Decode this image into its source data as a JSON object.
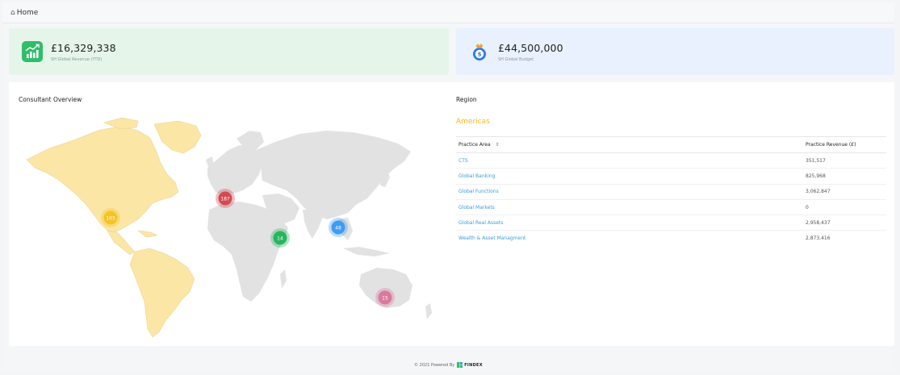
{
  "breadcrumb": {
    "label": "Home"
  },
  "cards": {
    "revenue": {
      "amount": "£16,329,338",
      "label": "SH Global Revenue (YTD)",
      "bg": "#e6f5ea",
      "icon": "growth-chart-icon"
    },
    "budget": {
      "amount": "£44,500,000",
      "label": "SH Global Budget",
      "bg": "#e8f1fd",
      "icon": "money-bag-icon"
    }
  },
  "overview": {
    "title": "Consultant Overview"
  },
  "map": {
    "markers": [
      {
        "region": "Americas",
        "value": "103",
        "color": "#f6c325"
      },
      {
        "region": "Europe",
        "value": "187",
        "color": "#d24a50"
      },
      {
        "region": "Africa",
        "value": "14",
        "color": "#27b65e"
      },
      {
        "region": "Asia",
        "value": "48",
        "color": "#3f9cf0"
      },
      {
        "region": "Oceania",
        "value": "15",
        "color": "#d9799e"
      }
    ]
  },
  "region": {
    "title": "Region",
    "selected": "Americas",
    "selected_color": "#f4b61d",
    "columns": {
      "area": "Practice Area",
      "revenue": "Practice Revenue (£)"
    },
    "rows": [
      {
        "area": "CTS",
        "revenue": "351,517"
      },
      {
        "area": "Global Banking",
        "revenue": "825,968"
      },
      {
        "area": "Global Functions",
        "revenue": "3,062,847"
      },
      {
        "area": "Global Markets",
        "revenue": "0"
      },
      {
        "area": "Global Real Assets",
        "revenue": "2,958,437"
      },
      {
        "area": "Wealth & Asset Managment",
        "revenue": "2,873,416"
      }
    ]
  },
  "footer": {
    "text": "© 2021 Powered By",
    "brand": "FINDEX"
  }
}
